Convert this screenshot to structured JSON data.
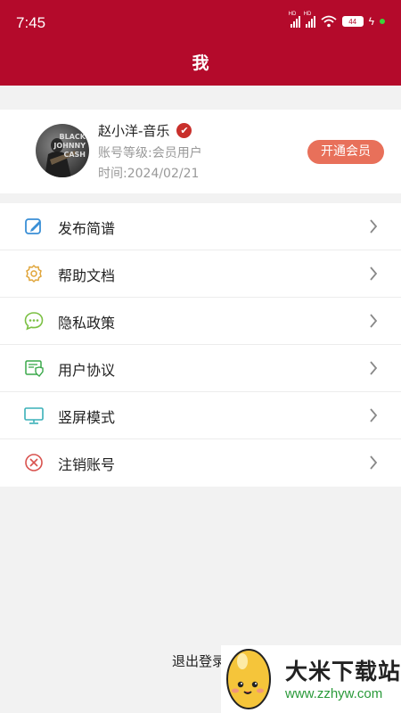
{
  "status_bar": {
    "time": "7:45",
    "battery": "44",
    "signal_label_1": "HD",
    "signal_label_2": "HD"
  },
  "header": {
    "title": "我",
    "background": "#b40a2b"
  },
  "profile": {
    "name": "赵小洋-音乐",
    "level": "账号等级:会员用户",
    "time": "时间:2024/02/21",
    "vip_button": "开通会员",
    "avatar_text": "BLACK JOHNNY CASH"
  },
  "menu": {
    "items": [
      {
        "label": "发布简谱",
        "icon": "edit-icon",
        "color": "#3a8fd6"
      },
      {
        "label": "帮助文档",
        "icon": "gear-icon",
        "color": "#e0a53a"
      },
      {
        "label": "隐私政策",
        "icon": "chat-bubble-icon",
        "color": "#7bc043"
      },
      {
        "label": "用户协议",
        "icon": "agreement-shield-icon",
        "color": "#3aa84a"
      },
      {
        "label": "竖屏模式",
        "icon": "monitor-icon",
        "color": "#3ab0b8"
      },
      {
        "label": "注销账号",
        "icon": "cancel-circle-icon",
        "color": "#d9534f"
      }
    ]
  },
  "logout": "退出登录",
  "watermark": {
    "title": "大米下载站",
    "url": "www.zzhyw.com"
  }
}
